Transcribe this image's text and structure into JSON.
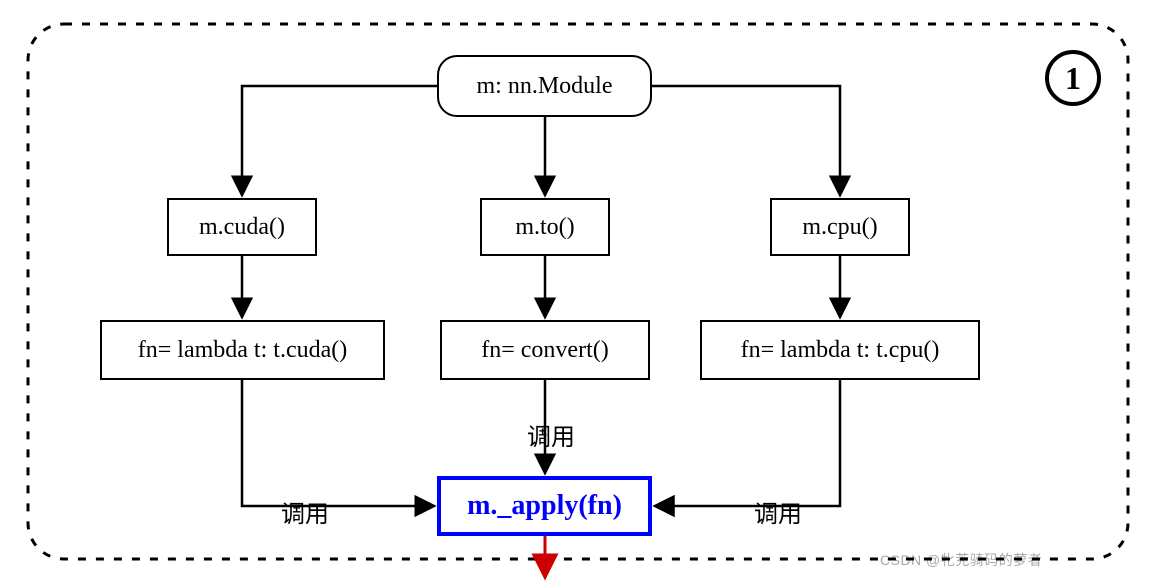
{
  "badge": "1",
  "nodes": {
    "root": "m: nn.Module",
    "cuda_call": "m.cuda()",
    "to_call": "m.to()",
    "cpu_call": "m.cpu()",
    "cuda_fn": "fn= lambda t: t.cuda()",
    "to_fn": "fn= convert()",
    "cpu_fn": "fn= lambda t: t.cpu()",
    "apply": "m._apply(fn)"
  },
  "edge_labels": {
    "left": "调用",
    "center": "调用",
    "right": "调用"
  },
  "watermark": "CSDN @牝茺骑码的萝者"
}
